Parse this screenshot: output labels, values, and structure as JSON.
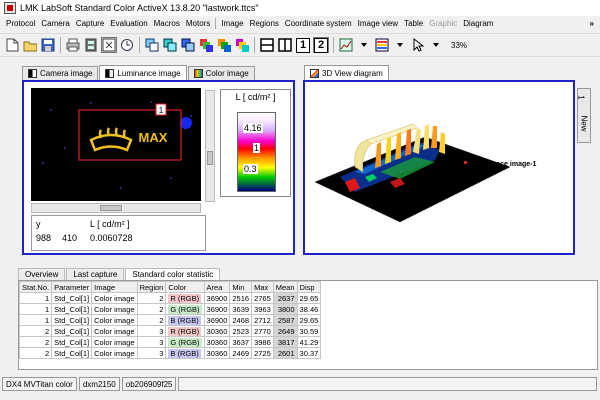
{
  "window": {
    "title": "LMK LabSoft Standard Color ActiveX 13.8.20 \"lastwork.ttcs\""
  },
  "menu": {
    "items": [
      "Protocol",
      "Camera",
      "Capture",
      "Evaluation",
      "Macros",
      "Motors",
      "Image",
      "Regions",
      "Coordinate system",
      "Image view",
      "Table",
      "Graphic",
      "Diagram"
    ],
    "more": "»"
  },
  "toolbar": {
    "view_button_1": "1",
    "view_button_2": "2",
    "zoom": "33%"
  },
  "left_tabs": [
    "Camera image",
    "Luminance image",
    "Color image"
  ],
  "right_tabs": [
    "3D View diagram"
  ],
  "image_view": {
    "overlay_text": "MAX",
    "region_label": "1",
    "accent_color": "#f0c020",
    "region_color": "#e02020"
  },
  "legend": {
    "title": "L [ cd/m² ]",
    "max": "4.16",
    "mid": "1",
    "min": "0.3"
  },
  "readout": {
    "header_y": "y",
    "header_l": "L [ cd/m² ]",
    "val_x": "988",
    "val_y": "410",
    "val_l": "0.0060728"
  },
  "diagram": {
    "legend_label": "Luminance image-1",
    "side_tab_label": "New",
    "side_tab_num": "1"
  },
  "bottom_tabs": [
    "Overview",
    "Last capture",
    "Standard color statistic"
  ],
  "table": {
    "columns": [
      "Stat.No.",
      "Parameter",
      "Image",
      "Region",
      "Color",
      "Area",
      "Min",
      "Max",
      "Mean",
      "Disp"
    ],
    "rows": [
      [
        "1",
        "Std_Col[1]",
        "Color image",
        "2",
        "R (RGB)",
        "36900",
        "2516",
        "2765",
        "2637",
        "29.65"
      ],
      [
        "1",
        "Std_Col[1]",
        "Color image",
        "2",
        "G (RGB)",
        "36900",
        "3639",
        "3963",
        "3800",
        "38.46"
      ],
      [
        "1",
        "Std_Col[1]",
        "Color image",
        "2",
        "B (RGB)",
        "36900",
        "2468",
        "2712",
        "2587",
        "29.65"
      ],
      [
        "2",
        "Std_Col[1]",
        "Color image",
        "3",
        "R (RGB)",
        "30360",
        "2523",
        "2770",
        "2649",
        "30.59"
      ],
      [
        "2",
        "Std_Col[1]",
        "Color image",
        "3",
        "G (RGB)",
        "30360",
        "3637",
        "3986",
        "3817",
        "41.29"
      ],
      [
        "2",
        "Std_Col[1]",
        "Color image",
        "3",
        "B (RGB)",
        "30360",
        "2469",
        "2725",
        "2601",
        "30.37"
      ]
    ],
    "color_swatches": {
      "R (RGB)": "#f4c8c8",
      "G (RGB)": "#c8ecc8",
      "B (RGB)": "#c8c8f4"
    }
  },
  "status": {
    "camera": "DX4 MVTitan color",
    "lens": "dxm2150",
    "id": "ob206909f25"
  }
}
